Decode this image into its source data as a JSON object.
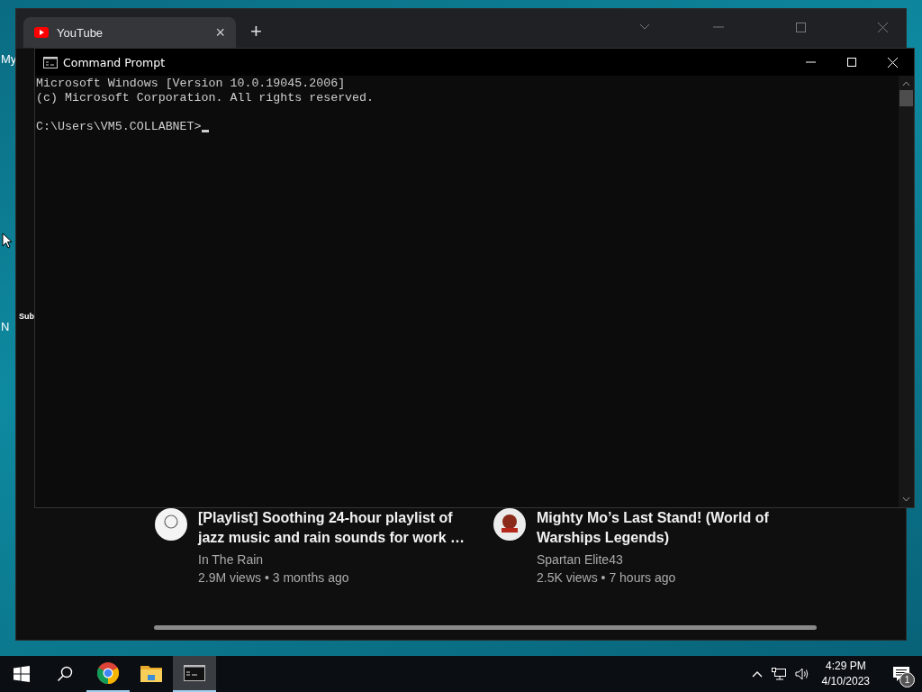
{
  "desktop": {
    "icon_labels": [
      "My",
      "N"
    ]
  },
  "browser": {
    "tabs": [
      {
        "title": "YouTube",
        "close": "×",
        "selected": true
      }
    ],
    "new_tab": "+",
    "partial_label": "Sub",
    "videos": [
      {
        "title": "[Playlist] Soothing 24-hour playlist of jazz music and rain sounds for work …",
        "channel": "In The Rain",
        "meta": "2.9M views • 3 months ago"
      },
      {
        "title": "Mighty Mo’s Last Stand! (World of Warships Legends)",
        "channel": "Spartan Elite43",
        "meta": "2.5K views • 7 hours ago"
      }
    ]
  },
  "console": {
    "title": "Command Prompt",
    "lines": [
      "Microsoft Windows [Version 10.0.19045.2006]",
      "(c) Microsoft Corporation. All rights reserved."
    ],
    "prompt": "C:\\Users\\VM5.COLLABNET>"
  },
  "taskbar": {
    "apps": [
      {
        "kind": "chrome",
        "running": true,
        "active": false
      },
      {
        "kind": "explorer",
        "running": false,
        "active": false
      },
      {
        "kind": "console",
        "running": true,
        "active": true
      }
    ],
    "time": "4:29 PM",
    "date": "4/10/2023",
    "notification_count": "1"
  }
}
